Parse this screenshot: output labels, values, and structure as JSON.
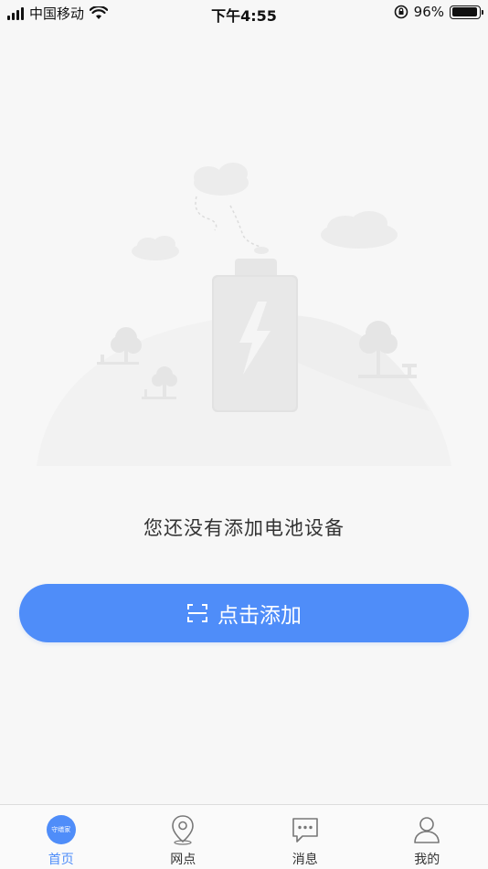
{
  "status_bar": {
    "carrier": "中国移动",
    "time": "下午4:55",
    "battery_percent": "96%",
    "battery_level": 0.96
  },
  "empty_state": {
    "message": "您还没有添加电池设备",
    "illustration_icon": "battery-charging-illustration"
  },
  "add_button": {
    "label": "点击添加",
    "icon": "scan-icon",
    "color": "#4f8df9"
  },
  "tabs": [
    {
      "label": "首页",
      "icon": "home-badge-icon",
      "badge_text": "守缮家",
      "active": true
    },
    {
      "label": "网点",
      "icon": "location-pin-icon",
      "active": false
    },
    {
      "label": "消息",
      "icon": "message-icon",
      "active": false
    },
    {
      "label": "我的",
      "icon": "user-icon",
      "active": false
    }
  ],
  "colors": {
    "accent": "#4f8df9",
    "background": "#f7f7f7"
  }
}
